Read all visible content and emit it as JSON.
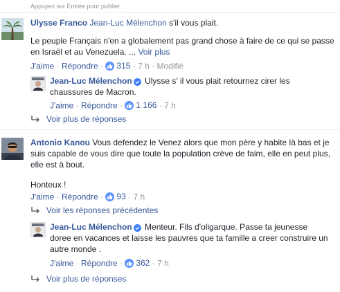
{
  "hint": "Appuyez sur Entrée pour publier.",
  "comments": [
    {
      "author": "Ulysse Franco",
      "mention": "Jean-Luc Mélenchon",
      "lead": "s'il vous plait.",
      "body": "Le peuple Français n'en a globalement pas grand chose à faire de ce qui se passe en Israël et au Venezuela. ...",
      "see_more": "Voir plus",
      "like": "J'aime",
      "reply": "Répondre",
      "count": "315",
      "time": "7 h",
      "edited": "Modifié",
      "reply_comment": {
        "author": "Jean-Luc Mélenchon",
        "body": "Ulysse s' il vous plait retournez cirer les chaussures de Macron.",
        "like": "J'aime",
        "reply": "Répondre",
        "count": "1 166",
        "time": "7 h"
      },
      "more_replies": "Voir plus de réponses"
    },
    {
      "author": "Antonio Kanou",
      "body": "Vous defendez le Venez alors que mon père y habite là bas et je suis capable de vous dire que toute la population crève de faim, elle en peut plus, elle est à bout.",
      "body2": "Honteux !",
      "like": "J'aime",
      "reply": "Répondre",
      "count": "93",
      "time": "7 h",
      "previous_replies": "Voir les réponses précédentes",
      "reply_comment": {
        "author": "Jean-Luc Mélenchon",
        "body": "Menteur. Fils d'oligarque. Passe ta jeunesse doree en vacances et laisse les pauvres que ta famille a creer construire un autre monde .",
        "like": "J'aime",
        "reply": "Répondre",
        "count": "362",
        "time": "7 h"
      },
      "more_replies": "Voir plus de réponses"
    }
  ],
  "separator": "·"
}
